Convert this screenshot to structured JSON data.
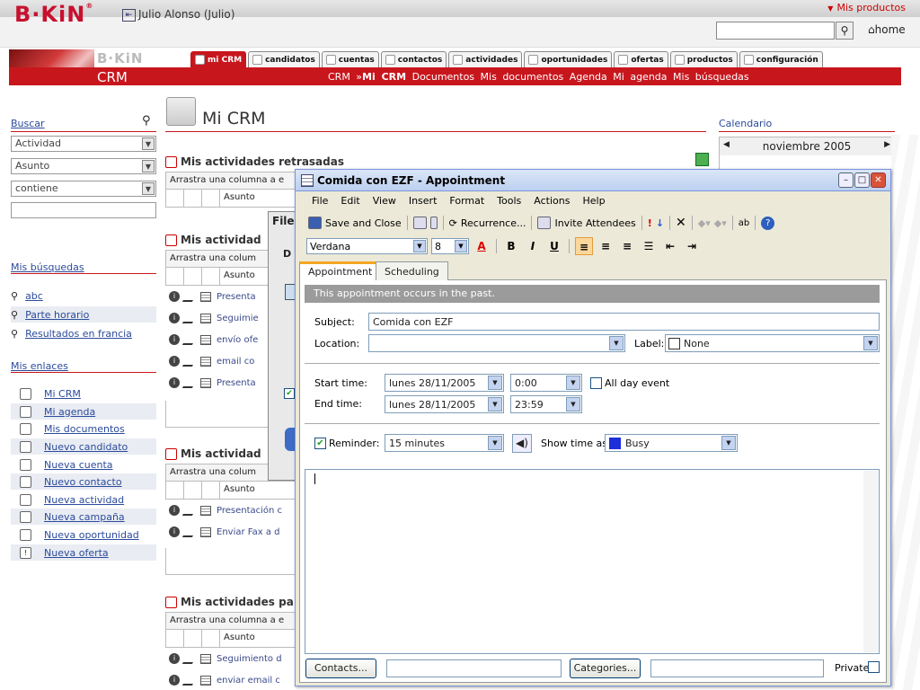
{
  "top": {
    "mis_productos": "Mis productos"
  },
  "header": {
    "logo": "B·KiN",
    "user": "Julio Alonso (Julio)",
    "home": "home",
    "banner_logo": "B·KiN",
    "banner_crm": "CRM"
  },
  "tabs": [
    "mi CRM",
    "candidatos",
    "cuentas",
    "contactos",
    "actividades",
    "oportunidades",
    "ofertas",
    "productos",
    "configuración"
  ],
  "subnav": {
    "prefix": "CRM »",
    "active": "Mi CRM",
    "items": [
      "Documentos",
      "Mis documentos",
      "Agenda",
      "Mi agenda",
      "Mis búsquedas"
    ]
  },
  "left": {
    "buscar": "Buscar",
    "selects": [
      "Actividad",
      "Asunto",
      "contiene"
    ],
    "mis_busquedas": "Mis búsquedas",
    "busquedas": [
      "abc",
      "Parte horario",
      "Resultados en francia"
    ],
    "mis_enlaces": "Mis enlaces",
    "enlaces": [
      "Mi CRM",
      "Mi agenda",
      "Mis documentos",
      "Nuevo candidato",
      "Nueva cuenta",
      "Nuevo contacto",
      "Nueva actividad",
      "Nueva campaña",
      "Nueva oportunidad",
      "Nueva oferta"
    ]
  },
  "main": {
    "title": "Mi CRM",
    "s1": {
      "title": "Mis actividades retrasadas",
      "drag": "Arrastra una columna a e",
      "col": "Asunto"
    },
    "s2": {
      "title": "Mis actividad",
      "drag": "Arrastra una colum",
      "col": "Asunto",
      "rows": [
        "Presenta",
        "Seguimie",
        "envío ofe",
        "email co",
        "Presenta"
      ]
    },
    "s3": {
      "title": "Mis actividad",
      "drag": "Arrastra una colum",
      "col": "Asunto",
      "rows": [
        "Presentación c",
        "Enviar Fax a d"
      ]
    },
    "s4": {
      "title": "Mis actividades pa",
      "drag": "Arrastra una columna a e",
      "col": "Asunto",
      "rows": [
        "Seguimiento d",
        "enviar email c"
      ]
    },
    "behind_title": "File",
    "behind_letter": "D"
  },
  "calendar": {
    "title": "Calendario",
    "month": "noviembre 2005"
  },
  "appointment": {
    "title": "Comida con EZF - Appointment",
    "menu": [
      "File",
      "Edit",
      "View",
      "Insert",
      "Format",
      "Tools",
      "Actions",
      "Help"
    ],
    "toolbar": {
      "save_close": "Save and Close",
      "recurrence": "Recurrence...",
      "invite": "Invite Attendees"
    },
    "font": "Verdana",
    "size": "8",
    "tabs": [
      "Appointment",
      "Scheduling"
    ],
    "info": "This appointment occurs in the past.",
    "subject_label": "Subject:",
    "subject": "Comida con EZF",
    "location_label": "Location:",
    "location": "",
    "label_label": "Label:",
    "label_value": "None",
    "start_label": "Start time:",
    "start_date": "lunes 28/11/2005",
    "start_time": "0:00",
    "allday": "All day event",
    "end_label": "End time:",
    "end_date": "lunes 28/11/2005",
    "end_time": "23:59",
    "reminder_label": "Reminder:",
    "reminder": "15 minutes",
    "showas_label": "Show time as:",
    "showas": "Busy",
    "contacts_btn": "Contacts...",
    "categories_btn": "Categories...",
    "private": "Private"
  }
}
